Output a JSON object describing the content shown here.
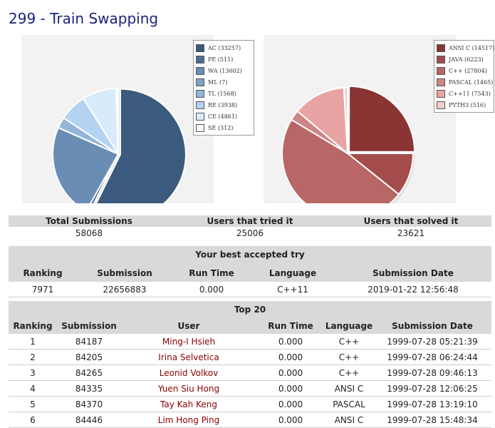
{
  "page": {
    "title": "299 - Train Swapping"
  },
  "verdict_chart": {
    "legend": [
      {
        "label": "AC (33257)",
        "value": 33257,
        "color": "#3b5b7e"
      },
      {
        "label": "PE (511)",
        "value": 511,
        "color": "#4b6d92"
      },
      {
        "label": "WA (13602)",
        "value": 13602,
        "color": "#6a8eb3"
      },
      {
        "label": "ML (7)",
        "value": 7,
        "color": "#7fa2c6"
      },
      {
        "label": "TL (1568)",
        "value": 1568,
        "color": "#93b5d8"
      },
      {
        "label": "RE (3938)",
        "value": 3938,
        "color": "#b3d3f3"
      },
      {
        "label": "CE (4861)",
        "value": 4861,
        "color": "#d6ebfb"
      },
      {
        "label": "SE (312)",
        "value": 312,
        "color": "#f1f8fd"
      }
    ]
  },
  "language_chart": {
    "legend": [
      {
        "label": "ANSI C (14517)",
        "value": 14517,
        "color": "#8a3434"
      },
      {
        "label": "JAVA (6223)",
        "value": 6223,
        "color": "#a44c4c"
      },
      {
        "label": "C++ (27804)",
        "value": 27804,
        "color": "#b96666"
      },
      {
        "label": "PASCAL (1465)",
        "value": 1465,
        "color": "#cd8585"
      },
      {
        "label": "C++11 (7543)",
        "value": 7543,
        "color": "#e8a3a3"
      },
      {
        "label": "PYTH3 (516)",
        "value": 516,
        "color": "#f7cccc"
      }
    ]
  },
  "stats": {
    "headers": [
      "Total Submissions",
      "Users that tried it",
      "Users that solved it"
    ],
    "values": [
      "58068",
      "25006",
      "23621"
    ]
  },
  "best_try": {
    "caption": "Your best accepted try",
    "headers": [
      "Ranking",
      "Submission",
      "Run Time",
      "Language",
      "Submission Date"
    ],
    "row": [
      "7971",
      "22656883",
      "0.000",
      "C++11",
      "2019-01-22 12:56:48"
    ]
  },
  "top20": {
    "caption": "Top 20",
    "headers": [
      "Ranking",
      "Submission",
      "User",
      "Run Time",
      "Language",
      "Submission Date"
    ],
    "rows": [
      [
        "1",
        "84187",
        "Ming-I Hsieh",
        "0.000",
        "C++",
        "1999-07-28 05:21:39"
      ],
      [
        "2",
        "84205",
        "Irina Selvetica",
        "0.000",
        "C++",
        "1999-07-28 06:24:44"
      ],
      [
        "3",
        "84265",
        "Leonid Volkov",
        "0.000",
        "C++",
        "1999-07-28 09:46:13"
      ],
      [
        "4",
        "84335",
        "Yuen Siu Hong",
        "0.000",
        "ANSI C",
        "1999-07-28 12:06:25"
      ],
      [
        "5",
        "84370",
        "Tay Kah Keng",
        "0.000",
        "PASCAL",
        "1999-07-28 13:19:10"
      ],
      [
        "6",
        "84446",
        "Lim Hong Ping",
        "0.000",
        "ANSI C",
        "1999-07-28 15:48:34"
      ]
    ]
  }
}
